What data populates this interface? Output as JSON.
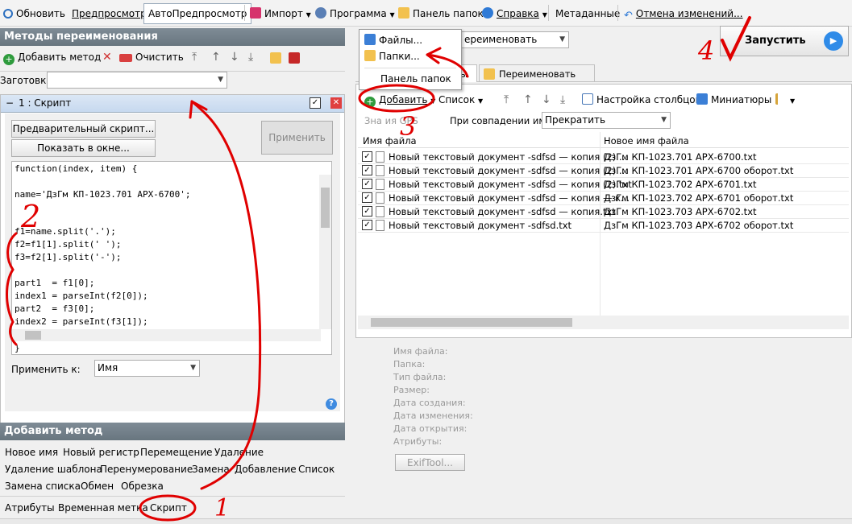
{
  "toolbar": {
    "refresh": "Обновить",
    "preview": "Предпросмотр",
    "autopreview": "АвтоПредпросмотр",
    "import": "Импорт",
    "program": "Программа",
    "folders_panel": "Панель папок",
    "help": "Справка",
    "metadata": "Метаданные",
    "undo": "Отмена изменений..."
  },
  "left": {
    "methods_title": "Методы переименования",
    "add_method": "Добавить метод",
    "clear": "Очистить",
    "presets_label": "Заготовки:",
    "method_item": "1 : Скрипт",
    "pre_script": "Предварительный скрипт...",
    "show_window": "Показать в окне...",
    "apply": "Применить",
    "apply_to_label": "Применить к:",
    "apply_to_value": "Имя",
    "add_method_title": "Добавить метод"
  },
  "code": {
    "l1": "function(index, item) {",
    "l2": "name='ДзГм КП-1023.701 АРХ-6700';",
    "l3": "f1=name.split('.');",
    "l4": "f2=f1[1].split(' ');",
    "l5": "f3=f2[1].split('-');",
    "l6": "part1  = f1[0];",
    "l7": "index1 = parseInt(f2[0]);",
    "l8": "part2  = f3[0];",
    "l9": "index2 = parseInt(f3[1]);",
    "l10": "}"
  },
  "methods": {
    "m1": "Новое имя",
    "m2": "Новый регистр",
    "m3": "Перемещение",
    "m4": "Удаление",
    "m5": "Удаление шаблона",
    "m6": "Перенумерование",
    "m7": "Замена",
    "m8": "Добавление",
    "m9": "Список",
    "m10": "Замена списка",
    "m11": "Обмен",
    "m12": "Обрезка",
    "m13": "Атрибуты",
    "m14": "Временная метка",
    "m15": "Скрипт"
  },
  "right": {
    "files_menu": "Файлы...",
    "folders_menu": "Папки...",
    "panel_menu": "Панель папок",
    "rename_combo": "ереименовать",
    "tab_files": "лы",
    "tab_rename_folders": "Переименовать Папки",
    "add": "Добавить",
    "list": "Список",
    "columns": "Настройка столбцов",
    "thumbnails": "Миниатюры",
    "gps": "Зна    ия GPS",
    "match_label": "При совпадении имен:",
    "match_value": "Прекратить",
    "run": "Запустить",
    "col1": "Имя файла",
    "col2": "Новое имя файла",
    "exiftool": "ExifTool..."
  },
  "rows": [
    {
      "old": "Новый текстовый документ -sdfsd — копия (2) ...",
      "new": "ДзГм КП-1023.701 АРХ-6700.txt"
    },
    {
      "old": "Новый текстовый документ -sdfsd — копия (2) ...",
      "new": "ДзГм КП-1023.701 АРХ-6700 оборот.txt"
    },
    {
      "old": "Новый текстовый документ -sdfsd — копия (2).txt",
      "new": "ДзГм КП-1023.702 АРХ-6701.txt"
    },
    {
      "old": "Новый текстовый документ -sdfsd — копия — к...",
      "new": "ДзГм КП-1023.702 АРХ-6701 оборот.txt"
    },
    {
      "old": "Новый текстовый документ -sdfsd — копия.txt",
      "new": "ДзГм КП-1023.703 АРХ-6702.txt"
    },
    {
      "old": "Новый текстовый документ -sdfsd.txt",
      "new": "ДзГм КП-1023.703 АРХ-6702 оборот.txt"
    }
  ],
  "meta": {
    "a": "Имя файла:",
    "b": "Папка:",
    "c": "Тип файла:",
    "d": "Размер:",
    "e": "Дата создания:",
    "f": "Дата изменения:",
    "g": "Дата открытия:",
    "h": "Атрибуты:"
  },
  "annotations": {
    "n1": "1",
    "n2": "2",
    "n3": "3",
    "n4": "4"
  },
  "colors": {
    "accent": "#3b7fd6",
    "annotation": "#e00000",
    "header": "#6f7d86"
  }
}
